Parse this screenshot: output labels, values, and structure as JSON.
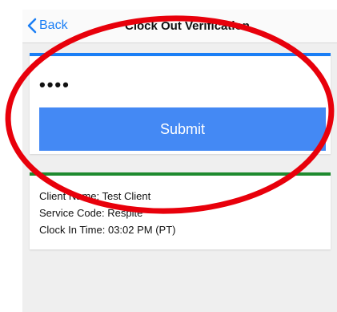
{
  "nav": {
    "back_label": "Back",
    "title": "Clock Out Verification"
  },
  "verify_card": {
    "password_masked": "••••",
    "submit_label": "Submit"
  },
  "info_card": {
    "client_name": "Client Name: Test Client",
    "service_code": "Service Code: Respite",
    "clock_in_time": "Clock In Time: 03:02 PM (PT)"
  },
  "colors": {
    "ios_blue": "#1a7ef5",
    "submit_blue": "#4489f4",
    "success_green": "#1e8a2e",
    "annotation_red": "#e8000b"
  },
  "icons": {
    "back": "chevron-left-icon"
  }
}
